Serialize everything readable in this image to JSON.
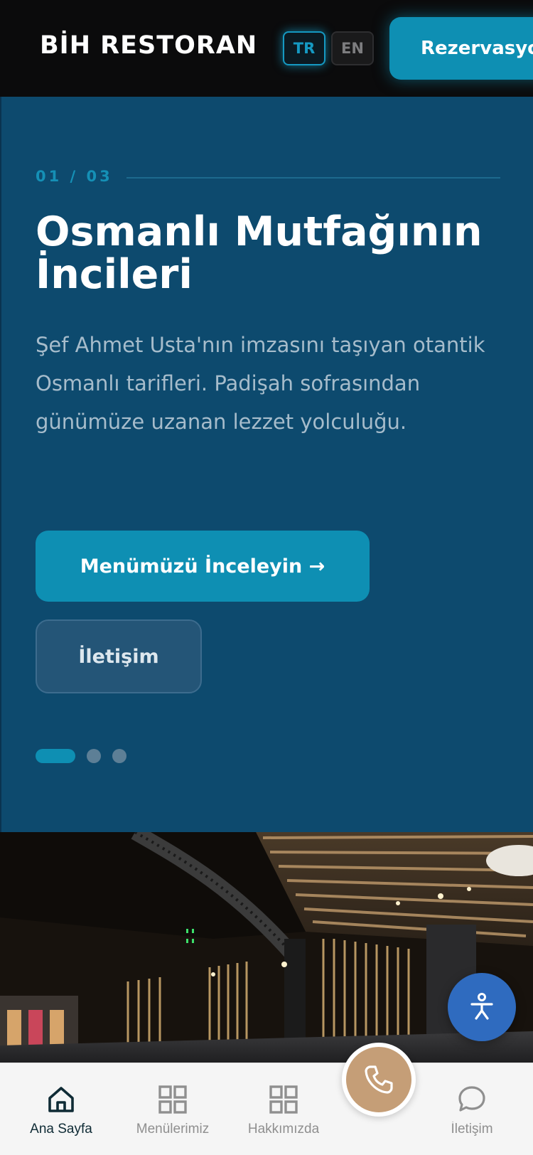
{
  "header": {
    "brand": "BİH RESTORAN",
    "lang_tr": "TR",
    "lang_en": "EN",
    "reserve_label": "Rezervasyon"
  },
  "hero": {
    "counter": "01 / 03",
    "title": "Osmanlı Mutfağının İncileri",
    "description": "Şef Ahmet Usta'nın imzasını taşıyan otantik Osmanlı tarifleri. Padişah sofrasından günümüze uzanan lezzet yolculuğu.",
    "primary_button": "Menümüzü İnceleyin →",
    "secondary_button": "İletişim",
    "slides_total": 3,
    "active_slide": 1
  },
  "bottom_nav": {
    "items": [
      {
        "label": "Ana Sayfa",
        "icon": "home-icon",
        "active": true
      },
      {
        "label": "Menülerimiz",
        "icon": "grid-icon",
        "active": false
      },
      {
        "label": "Hakkımızda",
        "icon": "grid-icon",
        "active": false
      },
      {
        "label": "İletişim",
        "icon": "chat-bubble-icon",
        "active": false
      }
    ],
    "call_icon": "phone-icon"
  },
  "accessibility_icon": "accessibility-icon",
  "colors": {
    "accent": "#0e8fb3",
    "hero_bg": "#0d4a6e",
    "header_bg": "#0b0b0c",
    "call_fab": "#c59e77",
    "a11y_fab": "#2f6bbf"
  }
}
